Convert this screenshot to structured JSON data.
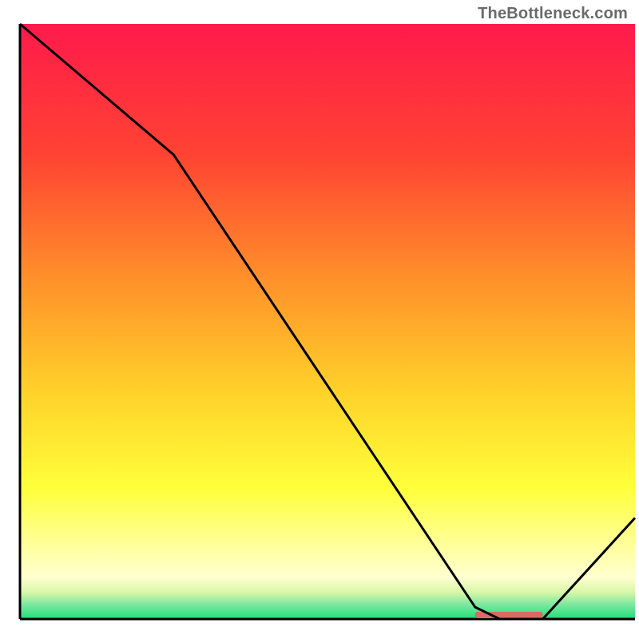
{
  "watermark": "TheBottleneck.com",
  "chart_data": {
    "type": "line",
    "title": "",
    "xlabel": "",
    "ylabel": "",
    "xlim": [
      0,
      100
    ],
    "ylim": [
      0,
      100
    ],
    "x": [
      0,
      25,
      74,
      78,
      85,
      100
    ],
    "values": [
      100,
      78,
      2,
      0,
      0,
      17
    ],
    "highlight_segment": {
      "x0": 74,
      "x1": 85,
      "y": 0,
      "color": "#d86b63"
    },
    "gradient_stops": [
      {
        "offset": 0.0,
        "color": "#ff1a4b"
      },
      {
        "offset": 0.22,
        "color": "#ff4333"
      },
      {
        "offset": 0.42,
        "color": "#ff8d2a"
      },
      {
        "offset": 0.62,
        "color": "#ffd22a"
      },
      {
        "offset": 0.78,
        "color": "#ffff3a"
      },
      {
        "offset": 0.88,
        "color": "#ffffa0"
      },
      {
        "offset": 0.93,
        "color": "#ffffd0"
      },
      {
        "offset": 0.955,
        "color": "#d8f7a8"
      },
      {
        "offset": 0.975,
        "color": "#7fe8a0"
      },
      {
        "offset": 1.0,
        "color": "#1ee07a"
      }
    ],
    "axis_color": "#000000",
    "line_color": "#000000",
    "line_width": 3
  }
}
